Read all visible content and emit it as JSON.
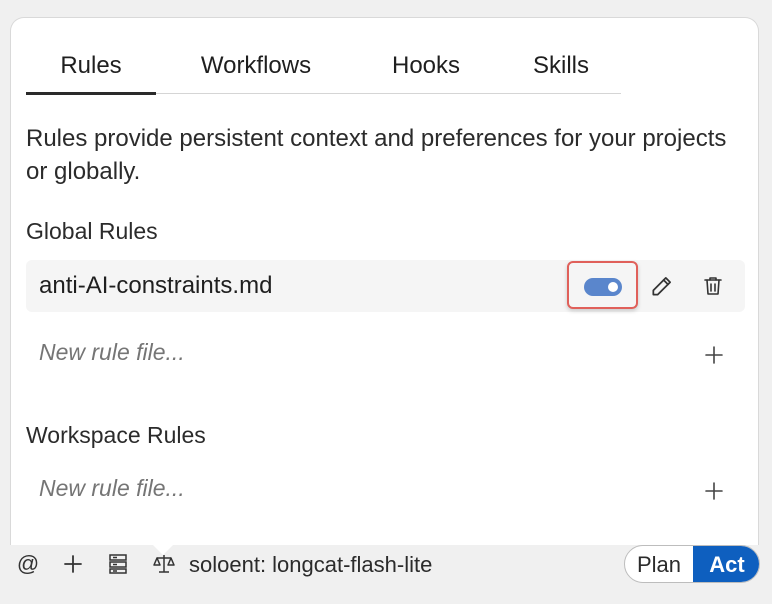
{
  "tabs": [
    {
      "label": "Rules",
      "active": true
    },
    {
      "label": "Workflows",
      "active": false
    },
    {
      "label": "Hooks",
      "active": false
    },
    {
      "label": "Skills",
      "active": false
    }
  ],
  "description": "Rules provide persistent context and preferences for your projects or globally.",
  "global": {
    "title": "Global Rules",
    "rules": [
      {
        "name": "anti-AI-constraints.md",
        "enabled": true
      }
    ],
    "new_placeholder": "New rule file..."
  },
  "workspace": {
    "title": "Workspace Rules",
    "new_placeholder": "New rule file..."
  },
  "bottom": {
    "mention_icon": "@",
    "model_label": "soloent: longcat-flash-lite",
    "mode": {
      "plan": "Plan",
      "act": "Act",
      "selected": "Act"
    }
  },
  "colors": {
    "accent": "#0e5fbf",
    "toggle_on": "#5a86cc",
    "highlight_border": "#e0605a"
  },
  "icons": [
    "pencil-icon",
    "trash-icon",
    "plus-icon",
    "at-icon",
    "add-icon",
    "server-icon",
    "scale-icon"
  ]
}
